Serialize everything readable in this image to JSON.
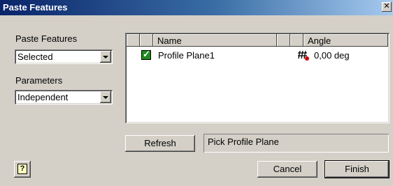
{
  "window": {
    "title": "Paste Features",
    "close_icon": "close-icon"
  },
  "left_panel": {
    "paste_label": "Paste Features",
    "paste_value": "Selected",
    "params_label": "Parameters",
    "params_value": "Independent"
  },
  "list": {
    "columns": [
      "",
      "",
      "Name",
      "",
      "",
      "Angle"
    ],
    "rows": [
      {
        "checked": true,
        "name": "Profile Plane1",
        "icon": "profile-plane-icon",
        "angle": "0,00 deg"
      }
    ]
  },
  "buttons": {
    "refresh": "Refresh",
    "cancel": "Cancel",
    "finish": "Finish",
    "help_glyph": "?"
  },
  "status": {
    "text": "Pick Profile Plane"
  }
}
